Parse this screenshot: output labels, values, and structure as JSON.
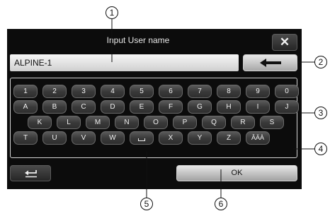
{
  "callouts": [
    "1",
    "2",
    "3",
    "4",
    "5",
    "6"
  ],
  "screen": {
    "title": "Input User name",
    "close_label": "✕",
    "input": {
      "value": "ALPINE-1"
    },
    "backspace_icon": "left-arrow-icon",
    "keyboard": {
      "rows": [
        [
          "1",
          "2",
          "3",
          "4",
          "5",
          "6",
          "7",
          "8",
          "9",
          "0"
        ],
        [
          "A",
          "B",
          "C",
          "D",
          "E",
          "F",
          "G",
          "H",
          "I",
          "J"
        ],
        [
          "K",
          "L",
          "M",
          "N",
          "O",
          "P",
          "Q",
          "R",
          "S"
        ],
        [
          "T",
          "U",
          "V",
          "W",
          "",
          "X",
          "Y",
          "Z",
          "ÂÄÀ"
        ]
      ],
      "space_icon": "space-bar-icon"
    },
    "return_icon": "return-arrow-icon",
    "ok_label": "OK"
  }
}
